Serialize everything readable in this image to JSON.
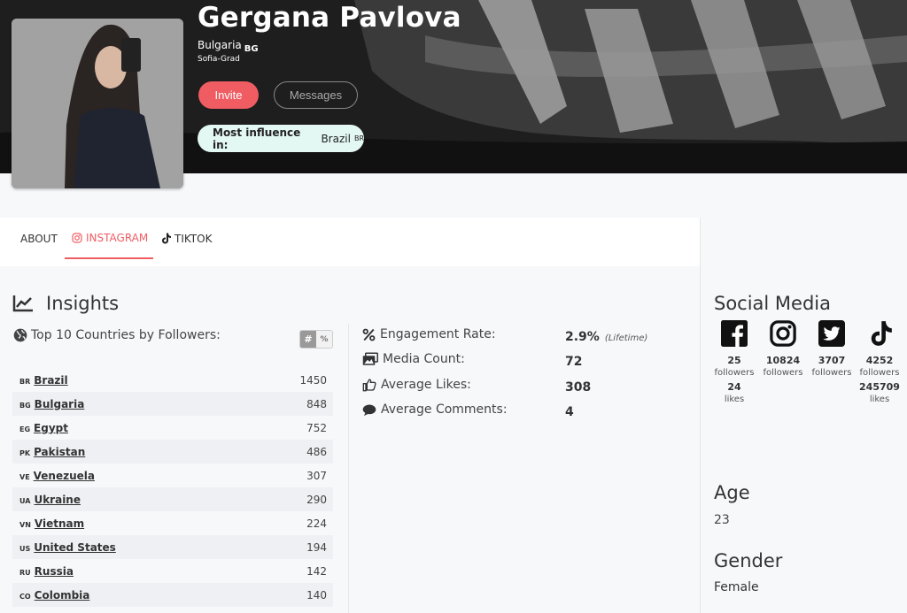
{
  "profile": {
    "name": "Gergana Pavlova",
    "country": "Bulgaria",
    "country_code": "BG",
    "city": "Sofia-Grad",
    "invite_label": "Invite",
    "messages_label": "Messages",
    "influence_label": "Most influence in:",
    "influence_country": "Brazil",
    "influence_code": "BR"
  },
  "tabs": [
    {
      "label": "ABOUT",
      "icon": "none",
      "active": false
    },
    {
      "label": "INSTAGRAM",
      "icon": "instagram-icon",
      "active": true
    },
    {
      "label": "TIKTOK",
      "icon": "tiktok-icon",
      "active": false
    }
  ],
  "insights": {
    "title": "Insights",
    "top_countries_label": "Top 10 Countries by Followers:",
    "toggle": {
      "hash": "#",
      "percent": "%"
    },
    "countries": [
      {
        "code": "BR",
        "name": "Brazil",
        "value": "1450"
      },
      {
        "code": "BG",
        "name": "Bulgaria",
        "value": "848"
      },
      {
        "code": "EG",
        "name": "Egypt",
        "value": "752"
      },
      {
        "code": "PK",
        "name": "Pakistan",
        "value": "486"
      },
      {
        "code": "VE",
        "name": "Venezuela",
        "value": "307"
      },
      {
        "code": "UA",
        "name": "Ukraine",
        "value": "290"
      },
      {
        "code": "VN",
        "name": "Vietnam",
        "value": "224"
      },
      {
        "code": "US",
        "name": "United States",
        "value": "194"
      },
      {
        "code": "RU",
        "name": "Russia",
        "value": "142"
      },
      {
        "code": "CO",
        "name": "Colombia",
        "value": "140"
      }
    ],
    "metrics": {
      "engagement_label": "Engagement Rate:",
      "engagement_value": "2.9%",
      "engagement_note": "(Lifetime)",
      "media_label": "Media Count:",
      "media_value": "72",
      "likes_label": "Average Likes:",
      "likes_value": "308",
      "comments_label": "Average Comments:",
      "comments_value": "4"
    }
  },
  "social": {
    "title": "Social Media",
    "networks": [
      {
        "icon": "facebook-icon",
        "followers": "25",
        "followers_label": "followers",
        "likes": "24",
        "likes_label": "likes"
      },
      {
        "icon": "instagram-icon",
        "followers": "10824",
        "followers_label": "followers"
      },
      {
        "icon": "twitter-icon",
        "followers": "3707",
        "followers_label": "followers"
      },
      {
        "icon": "tiktok-icon",
        "followers": "4252",
        "followers_label": "followers",
        "likes": "245709",
        "likes_label": "likes"
      }
    ]
  },
  "about": {
    "age_title": "Age",
    "age_value": "23",
    "gender_title": "Gender",
    "gender_value": "Female"
  },
  "colors": {
    "accent": "#ef5d63",
    "influence_bg": "#e4f8f3"
  }
}
